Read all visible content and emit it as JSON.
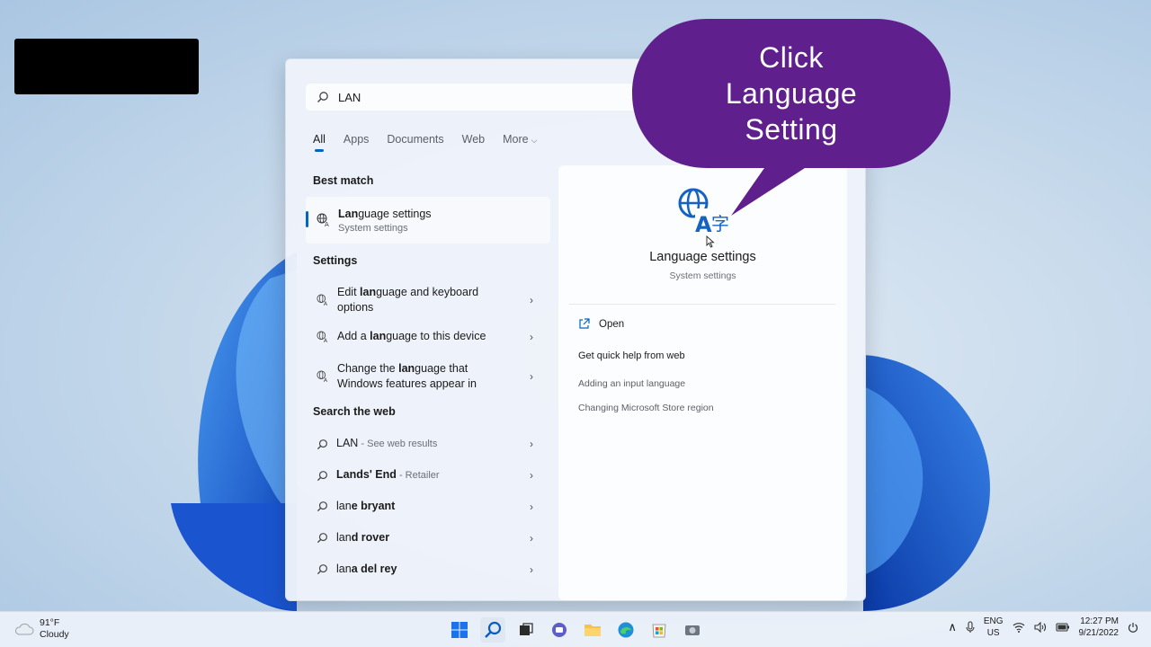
{
  "search": {
    "query": "LAN"
  },
  "tabs": [
    {
      "label": "All"
    },
    {
      "label": "Apps"
    },
    {
      "label": "Documents"
    },
    {
      "label": "Web"
    },
    {
      "label": "More"
    }
  ],
  "sections": {
    "best_match": "Best match",
    "settings": "Settings",
    "search_web": "Search the web"
  },
  "best_match": {
    "title_bold": "Lan",
    "title_rest": "guage settings",
    "subtitle": "System settings"
  },
  "settings_items": [
    {
      "pre": "Edit ",
      "bold": "lan",
      "post": "guage and keyboard",
      "line2": "options"
    },
    {
      "pre": "Add a ",
      "bold": "lan",
      "post": "guage to this device",
      "line2": ""
    },
    {
      "pre": "Change the ",
      "bold": "lan",
      "post": "guage that",
      "line2": "Windows features appear in"
    }
  ],
  "web_items": [
    {
      "bold": "",
      "text": "LAN",
      "suffix": " - See web results"
    },
    {
      "bold": "Lan",
      "text": "ds' End",
      "suffix": " - Retailer"
    },
    {
      "bold": "lan",
      "text": "e bryant",
      "suffix": ""
    },
    {
      "bold": "lan",
      "text": "d rover",
      "suffix": ""
    },
    {
      "bold": "lan",
      "text": "a del rey",
      "suffix": ""
    }
  ],
  "preview": {
    "title": "Language settings",
    "subtitle": "System settings",
    "open_label": "Open",
    "help_heading": "Get quick help from web",
    "links": [
      "Adding an input language",
      "Changing Microsoft Store region"
    ]
  },
  "callout": {
    "lines": [
      "Click",
      "Language",
      "Setting"
    ],
    "color": "#5f1f8c"
  },
  "taskbar": {
    "weather_temp": "91°F",
    "weather_desc": "Cloudy",
    "lang_line1": "ENG",
    "lang_line2": "US",
    "time": "12:27 PM",
    "date": "9/21/2022"
  },
  "colors": {
    "accent": "#0067c0",
    "wallpaper_bloom": "#1d5fd6"
  }
}
